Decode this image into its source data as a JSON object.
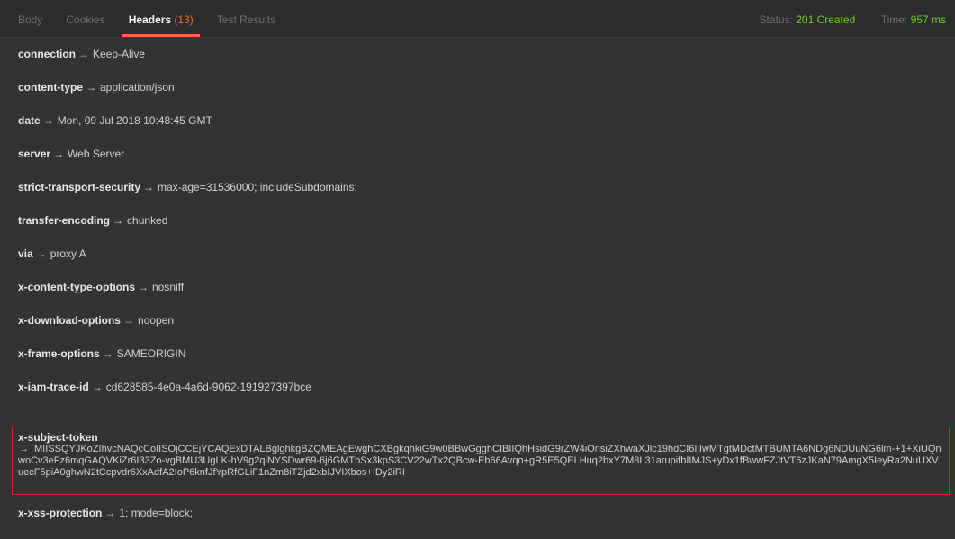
{
  "tabs": [
    {
      "label": "Body",
      "active": false
    },
    {
      "label": "Cookies",
      "active": false
    },
    {
      "label": "Headers",
      "count": "(13)",
      "active": true
    },
    {
      "label": "Test Results",
      "active": false
    }
  ],
  "status": {
    "label": "Status:",
    "value": "201 Created",
    "value_color": "#6bd12c"
  },
  "time": {
    "label": "Time:",
    "value": "957 ms",
    "value_color": "#6bd12c"
  },
  "accent_color": "#f26b3a",
  "arrow": "→",
  "headers": [
    {
      "key": "connection",
      "value": "Keep-Alive"
    },
    {
      "key": "content-type",
      "value": "application/json"
    },
    {
      "key": "date",
      "value": "Mon, 09 Jul 2018 10:48:45 GMT"
    },
    {
      "key": "server",
      "value": "Web Server"
    },
    {
      "key": "strict-transport-security",
      "value": "max-age=31536000; includeSubdomains;"
    },
    {
      "key": "transfer-encoding",
      "value": "chunked"
    },
    {
      "key": "via",
      "value": "proxy A"
    },
    {
      "key": "x-content-type-options",
      "value": "nosniff"
    },
    {
      "key": "x-download-options",
      "value": "noopen"
    },
    {
      "key": "x-frame-options",
      "value": "SAMEORIGIN"
    },
    {
      "key": "x-iam-trace-id",
      "value": "cd628585-4e0a-4a6d-9062-191927397bce"
    }
  ],
  "subject_token": {
    "key": "x-subject-token",
    "value": "MIISSQYJKoZIhvcNAQcCoIISOjCCEjYCAQExDTALBglghkgBZQMEAgEwghCXBgkqhkiG9w0BBwGgghCIBIIQhHsidG9rZW4iOnsiZXhwaXJlc19hdCI6IjIwMTgtMDctMTBUMTA6NDg6NDUuNG6lm-+1+XiUQnwoCv3eFz6mqGAQVKiZr6I33Zo-vgBMU3UgLK-hV9g2qiNYSDwr69-6j6GMTbSx3kpS3CV22wTx2QBcw-Eb66Avqo+gR5E5QELHuq2bxY7M8L31arupifbIIMJS+yDx1fBwwFZJtVT6zJKaN79AmgX5IeyRa2NuUXVuecF5piA0ghwN2tCcpvdr6XxAdfA2IoP6knfJfYpRfGLiF1nZm8iTZjd2xbIJVIXbos+IDy2iRI"
  },
  "xss_protection": {
    "key": "x-xss-protection",
    "value": "1; mode=block;"
  }
}
